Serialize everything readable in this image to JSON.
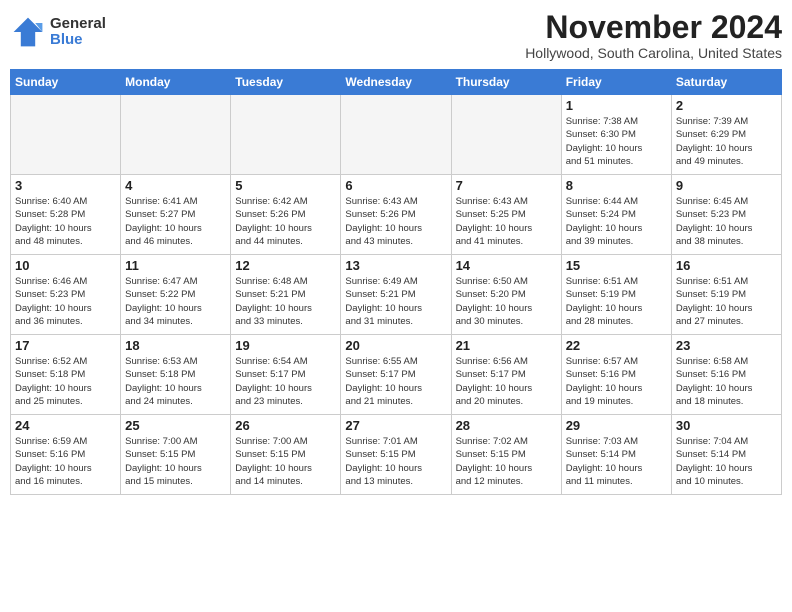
{
  "header": {
    "logo_general": "General",
    "logo_blue": "Blue",
    "month_title": "November 2024",
    "location": "Hollywood, South Carolina, United States"
  },
  "days_of_week": [
    "Sunday",
    "Monday",
    "Tuesday",
    "Wednesday",
    "Thursday",
    "Friday",
    "Saturday"
  ],
  "weeks": [
    [
      {
        "day": "",
        "info": ""
      },
      {
        "day": "",
        "info": ""
      },
      {
        "day": "",
        "info": ""
      },
      {
        "day": "",
        "info": ""
      },
      {
        "day": "",
        "info": ""
      },
      {
        "day": "1",
        "info": "Sunrise: 7:38 AM\nSunset: 6:30 PM\nDaylight: 10 hours\nand 51 minutes."
      },
      {
        "day": "2",
        "info": "Sunrise: 7:39 AM\nSunset: 6:29 PM\nDaylight: 10 hours\nand 49 minutes."
      }
    ],
    [
      {
        "day": "3",
        "info": "Sunrise: 6:40 AM\nSunset: 5:28 PM\nDaylight: 10 hours\nand 48 minutes."
      },
      {
        "day": "4",
        "info": "Sunrise: 6:41 AM\nSunset: 5:27 PM\nDaylight: 10 hours\nand 46 minutes."
      },
      {
        "day": "5",
        "info": "Sunrise: 6:42 AM\nSunset: 5:26 PM\nDaylight: 10 hours\nand 44 minutes."
      },
      {
        "day": "6",
        "info": "Sunrise: 6:43 AM\nSunset: 5:26 PM\nDaylight: 10 hours\nand 43 minutes."
      },
      {
        "day": "7",
        "info": "Sunrise: 6:43 AM\nSunset: 5:25 PM\nDaylight: 10 hours\nand 41 minutes."
      },
      {
        "day": "8",
        "info": "Sunrise: 6:44 AM\nSunset: 5:24 PM\nDaylight: 10 hours\nand 39 minutes."
      },
      {
        "day": "9",
        "info": "Sunrise: 6:45 AM\nSunset: 5:23 PM\nDaylight: 10 hours\nand 38 minutes."
      }
    ],
    [
      {
        "day": "10",
        "info": "Sunrise: 6:46 AM\nSunset: 5:23 PM\nDaylight: 10 hours\nand 36 minutes."
      },
      {
        "day": "11",
        "info": "Sunrise: 6:47 AM\nSunset: 5:22 PM\nDaylight: 10 hours\nand 34 minutes."
      },
      {
        "day": "12",
        "info": "Sunrise: 6:48 AM\nSunset: 5:21 PM\nDaylight: 10 hours\nand 33 minutes."
      },
      {
        "day": "13",
        "info": "Sunrise: 6:49 AM\nSunset: 5:21 PM\nDaylight: 10 hours\nand 31 minutes."
      },
      {
        "day": "14",
        "info": "Sunrise: 6:50 AM\nSunset: 5:20 PM\nDaylight: 10 hours\nand 30 minutes."
      },
      {
        "day": "15",
        "info": "Sunrise: 6:51 AM\nSunset: 5:19 PM\nDaylight: 10 hours\nand 28 minutes."
      },
      {
        "day": "16",
        "info": "Sunrise: 6:51 AM\nSunset: 5:19 PM\nDaylight: 10 hours\nand 27 minutes."
      }
    ],
    [
      {
        "day": "17",
        "info": "Sunrise: 6:52 AM\nSunset: 5:18 PM\nDaylight: 10 hours\nand 25 minutes."
      },
      {
        "day": "18",
        "info": "Sunrise: 6:53 AM\nSunset: 5:18 PM\nDaylight: 10 hours\nand 24 minutes."
      },
      {
        "day": "19",
        "info": "Sunrise: 6:54 AM\nSunset: 5:17 PM\nDaylight: 10 hours\nand 23 minutes."
      },
      {
        "day": "20",
        "info": "Sunrise: 6:55 AM\nSunset: 5:17 PM\nDaylight: 10 hours\nand 21 minutes."
      },
      {
        "day": "21",
        "info": "Sunrise: 6:56 AM\nSunset: 5:17 PM\nDaylight: 10 hours\nand 20 minutes."
      },
      {
        "day": "22",
        "info": "Sunrise: 6:57 AM\nSunset: 5:16 PM\nDaylight: 10 hours\nand 19 minutes."
      },
      {
        "day": "23",
        "info": "Sunrise: 6:58 AM\nSunset: 5:16 PM\nDaylight: 10 hours\nand 18 minutes."
      }
    ],
    [
      {
        "day": "24",
        "info": "Sunrise: 6:59 AM\nSunset: 5:16 PM\nDaylight: 10 hours\nand 16 minutes."
      },
      {
        "day": "25",
        "info": "Sunrise: 7:00 AM\nSunset: 5:15 PM\nDaylight: 10 hours\nand 15 minutes."
      },
      {
        "day": "26",
        "info": "Sunrise: 7:00 AM\nSunset: 5:15 PM\nDaylight: 10 hours\nand 14 minutes."
      },
      {
        "day": "27",
        "info": "Sunrise: 7:01 AM\nSunset: 5:15 PM\nDaylight: 10 hours\nand 13 minutes."
      },
      {
        "day": "28",
        "info": "Sunrise: 7:02 AM\nSunset: 5:15 PM\nDaylight: 10 hours\nand 12 minutes."
      },
      {
        "day": "29",
        "info": "Sunrise: 7:03 AM\nSunset: 5:14 PM\nDaylight: 10 hours\nand 11 minutes."
      },
      {
        "day": "30",
        "info": "Sunrise: 7:04 AM\nSunset: 5:14 PM\nDaylight: 10 hours\nand 10 minutes."
      }
    ]
  ]
}
